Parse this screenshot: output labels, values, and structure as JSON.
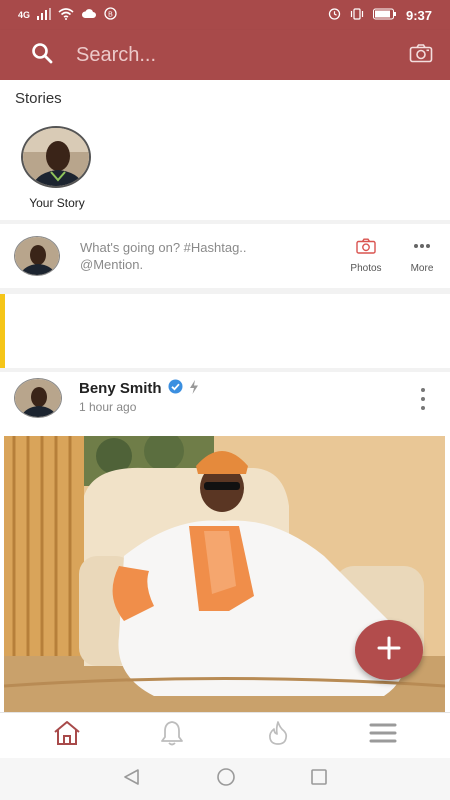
{
  "status_bar": {
    "network": "4G",
    "time": "9:37"
  },
  "search": {
    "placeholder": "Search..."
  },
  "stories": {
    "title": "Stories",
    "items": [
      {
        "label": "Your Story"
      }
    ]
  },
  "composer": {
    "placeholder_line1": "What's going on? #Hashtag..",
    "placeholder_line2": "@Mention.",
    "actions": [
      {
        "label": "Photos",
        "icon": "camera-icon"
      },
      {
        "label": "More",
        "icon": "more-horizontal-icon"
      }
    ]
  },
  "post": {
    "author": "Beny Smith",
    "verified": true,
    "time": "1 hour ago"
  },
  "bottom_nav": {
    "items": [
      {
        "name": "home",
        "icon": "home-icon",
        "active": true
      },
      {
        "name": "notifications",
        "icon": "bell-icon",
        "active": false
      },
      {
        "name": "trending",
        "icon": "fire-icon",
        "active": false
      },
      {
        "name": "menu",
        "icon": "hamburger-menu-icon",
        "active": false
      }
    ]
  },
  "colors": {
    "brand": "#a84a4a",
    "fab": "#b24c4c",
    "accent_yellow": "#f5c518",
    "verified_blue": "#3b8fe0"
  }
}
